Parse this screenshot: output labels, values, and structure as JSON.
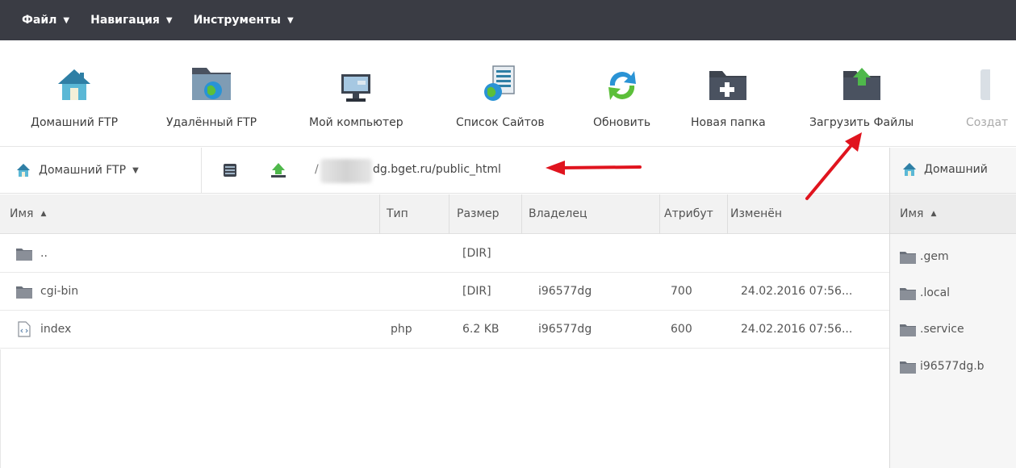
{
  "menu": [
    {
      "label": "Файл",
      "caret": "▼"
    },
    {
      "label": "Навигация",
      "caret": "▼"
    },
    {
      "label": "Инструменты",
      "caret": "▼"
    }
  ],
  "toolbar": {
    "home_ftp": "Домашний FTP",
    "remote_ftp": "Удалённый FTP",
    "my_computer": "Мой компьютер",
    "site_list": "Список Сайтов",
    "refresh": "Обновить",
    "new_folder": "Новая папка",
    "upload_files": "Загрузить Файлы",
    "create": "Создат"
  },
  "left_panel": {
    "site_dropdown": "Домашний FTP",
    "caret": "▼",
    "path_slash": "/",
    "path": "dg.bget.ru/public_html",
    "columns": {
      "name": "Имя",
      "sort_arrow": "▲",
      "type": "Тип",
      "size": "Размер",
      "owner": "Владелец",
      "attr": "Атрибут",
      "modified": "Изменён"
    },
    "rows": [
      {
        "name": "..",
        "type": "",
        "size": "[DIR]",
        "owner": "",
        "attr": "",
        "modified": ""
      },
      {
        "name": "cgi-bin",
        "type": "",
        "size": "[DIR]",
        "owner": "i96577dg",
        "attr": "700",
        "modified": "24.02.2016 07:56..."
      },
      {
        "name": "index",
        "type": "php",
        "size": "6.2 KB",
        "owner": "i96577dg",
        "attr": "600",
        "modified": "24.02.2016 07:56..."
      }
    ]
  },
  "right_panel": {
    "site": "Домашний",
    "column_name": "Имя",
    "sort_arrow": "▲",
    "rows": [
      ".gem",
      ".local",
      ".service",
      "i96577dg.b"
    ]
  },
  "colors": {
    "menubar_bg": "#3a3c44",
    "annotation_arrow": "#e0141e",
    "folder": "#8a8f98"
  }
}
